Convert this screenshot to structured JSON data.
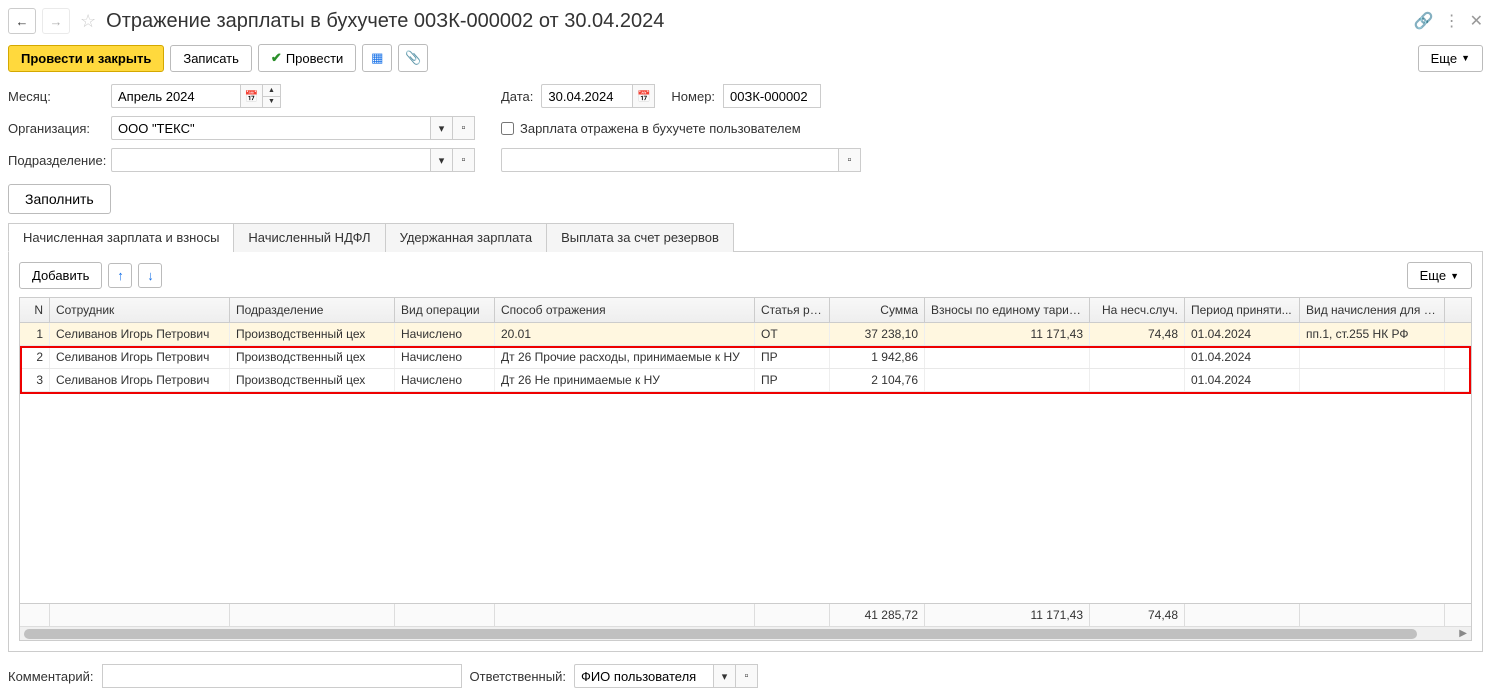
{
  "title": "Отражение зарплаты в бухучете 00ЗК-000002 от 30.04.2024",
  "toolbar": {
    "post_close": "Провести и закрыть",
    "save": "Записать",
    "post": "Провести",
    "more": "Еще"
  },
  "form": {
    "month_label": "Месяц:",
    "month_value": "Апрель 2024",
    "date_label": "Дата:",
    "date_value": "30.04.2024",
    "number_label": "Номер:",
    "number_value": "00ЗК-000002",
    "org_label": "Организация:",
    "org_value": "ООО \"ТЕКС\"",
    "dept_label": "Подразделение:",
    "dept_value": "",
    "reflected_label": "Зарплата отражена в бухучете пользователем",
    "extra_value": "",
    "fill": "Заполнить"
  },
  "tabs": [
    "Начисленная зарплата и взносы",
    "Начисленный НДФЛ",
    "Удержанная зарплата",
    "Выплата за счет резервов"
  ],
  "table": {
    "add": "Добавить",
    "more": "Еще",
    "columns": [
      "N",
      "Сотрудник",
      "Подразделение",
      "Вид операции",
      "Способ отражения",
      "Статья ра...",
      "Сумма",
      "Взносы по единому тарифу",
      "На несч.случ.",
      "Период приняти...",
      "Вид начисления для нал"
    ],
    "rows": [
      {
        "n": "1",
        "emp": "Селиванов Игорь Петрович",
        "dep": "Производственный цех",
        "op": "Начислено",
        "ref": "20.01",
        "art": "ОТ",
        "sum": "37 238,10",
        "vz": "11 171,43",
        "ins": "74,48",
        "per": "01.04.2024",
        "vid": "пп.1, ст.255 НК РФ"
      },
      {
        "n": "2",
        "emp": "Селиванов Игорь Петрович",
        "dep": "Производственный цех",
        "op": "Начислено",
        "ref": "Дт 26 Прочие расходы, принимаемые к НУ",
        "art": "ПР",
        "sum": "1 942,86",
        "vz": "",
        "ins": "",
        "per": "01.04.2024",
        "vid": ""
      },
      {
        "n": "3",
        "emp": "Селиванов Игорь Петрович",
        "dep": "Производственный цех",
        "op": "Начислено",
        "ref": "Дт 26 Не принимаемые к НУ",
        "art": "ПР",
        "sum": "2 104,76",
        "vz": "",
        "ins": "",
        "per": "01.04.2024",
        "vid": ""
      }
    ],
    "footer": {
      "sum": "41 285,72",
      "vz": "11 171,43",
      "ins": "74,48"
    }
  },
  "bottom": {
    "comment_label": "Комментарий:",
    "comment_value": "",
    "resp_label": "Ответственный:",
    "resp_value": "ФИО пользователя"
  }
}
